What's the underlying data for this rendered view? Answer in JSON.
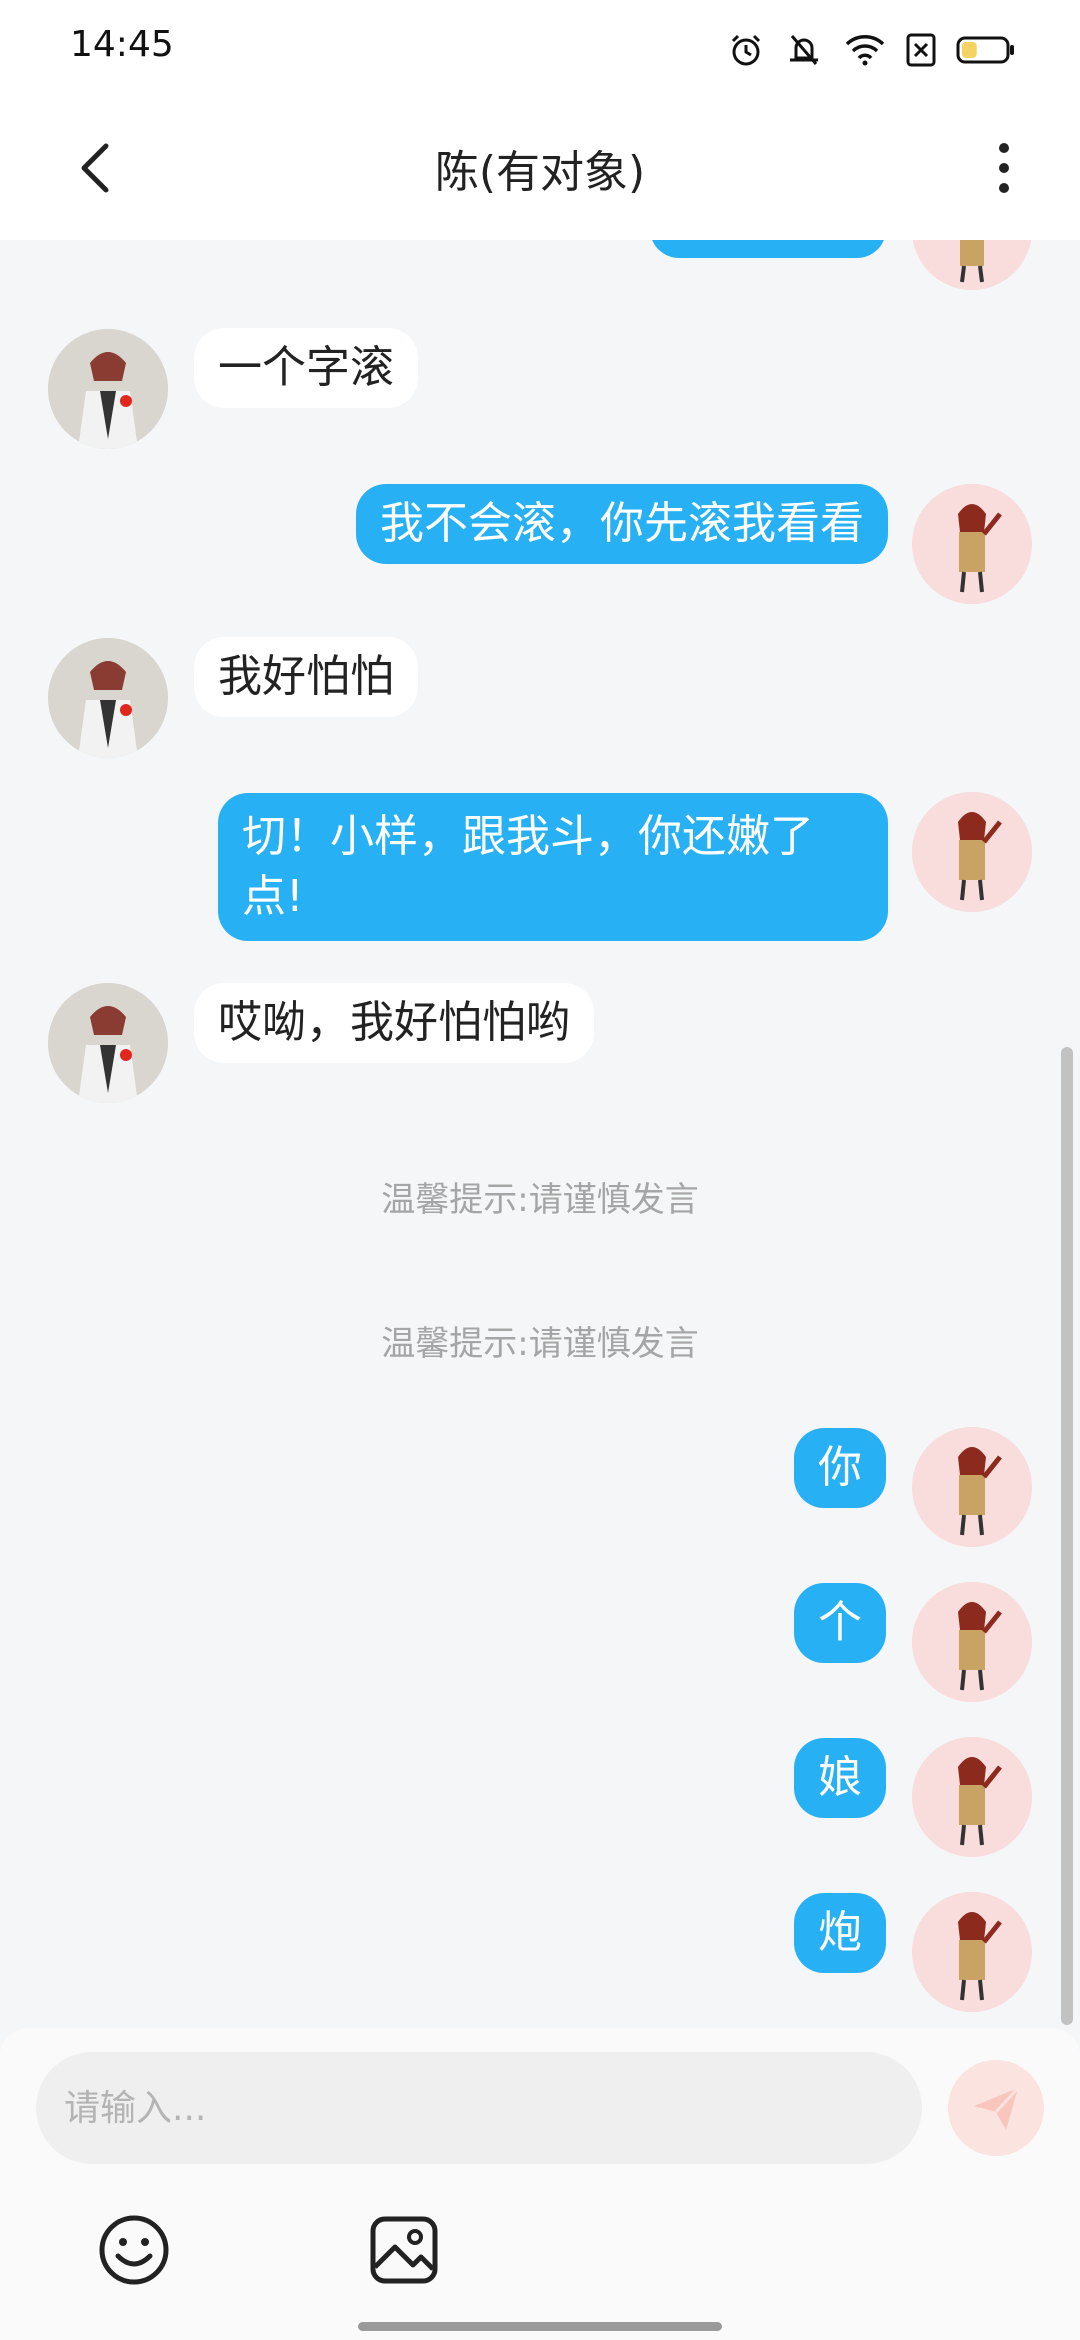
{
  "status_bar": {
    "time": "14:45",
    "battery_level": 0.35
  },
  "header": {
    "title": "陈(有对象)",
    "back_icon": "chevron-left-icon",
    "more_icon": "more-vertical-icon"
  },
  "messages": [
    {
      "from": "them",
      "text": "一个字滚"
    },
    {
      "from": "me",
      "text": "我不会滚，你先滚我看看"
    },
    {
      "from": "them",
      "text": "我好怕怕"
    },
    {
      "from": "me",
      "text": "切！小样，跟我斗，你还嫩了点!"
    },
    {
      "from": "them",
      "text": "哎呦，我好怕怕哟"
    },
    {
      "from": "me",
      "text": "你"
    },
    {
      "from": "me",
      "text": "个"
    },
    {
      "from": "me",
      "text": "娘"
    },
    {
      "from": "me",
      "text": "炮"
    }
  ],
  "tips": [
    "温馨提示:请谨慎发言",
    "温馨提示:请谨慎发言"
  ],
  "input": {
    "placeholder": "请输入..."
  },
  "toolbar": {
    "emoji_icon": "smiley-icon",
    "image_icon": "image-icon",
    "send_icon": "send-icon"
  },
  "colors": {
    "accent": "#27b1f4",
    "background": "#f4f6f8",
    "send_button": "#fbe3df"
  }
}
